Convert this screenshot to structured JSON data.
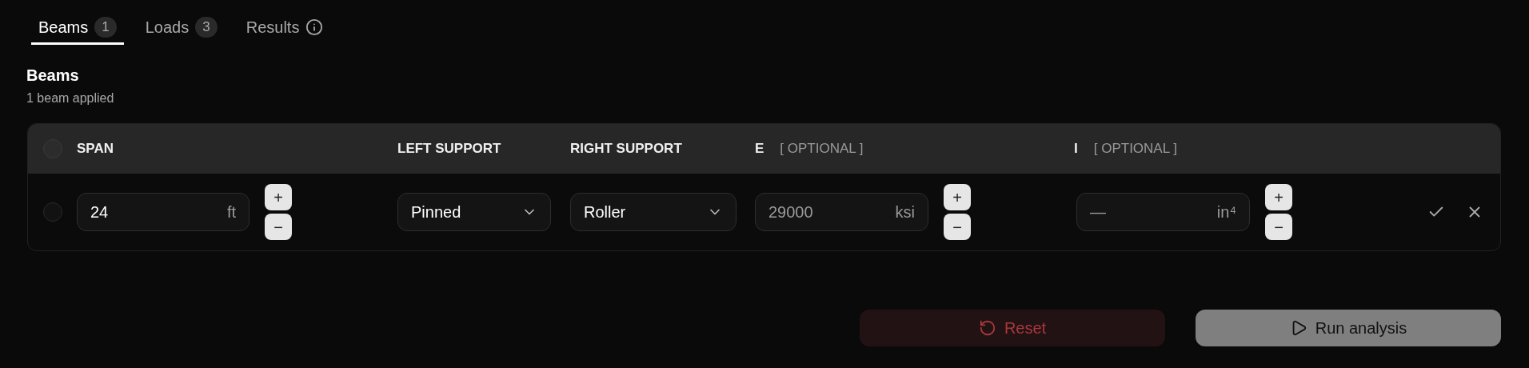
{
  "tabs": [
    {
      "label": "Beams",
      "count": "1",
      "selected": true
    },
    {
      "label": "Loads",
      "count": "3",
      "selected": false
    },
    {
      "label": "Results",
      "info": true,
      "selected": false
    }
  ],
  "section": {
    "title": "Beams",
    "subtitle": "1 beam applied"
  },
  "table": {
    "select_all_checked": false,
    "columns": [
      {
        "label": "SPAN"
      },
      {
        "label": "LEFT SUPPORT"
      },
      {
        "label": "RIGHT SUPPORT"
      },
      {
        "label": "E",
        "hint": "[ OPTIONAL ]"
      },
      {
        "label": "I",
        "hint": "[ OPTIONAL ]"
      }
    ],
    "rows": [
      {
        "checked": false,
        "span": {
          "value": "24",
          "unit": "ft",
          "increment": "+",
          "decrement": "−"
        },
        "left_support": "Pinned",
        "right_support": "Roller",
        "e": {
          "placeholder": "29000",
          "unit": "ksi",
          "increment": "+",
          "decrement": "−"
        },
        "i": {
          "placeholder": "—",
          "unit": "in⁴",
          "increment": "+",
          "decrement": "−"
        }
      }
    ]
  },
  "buttons": [
    {
      "kind": "reset",
      "label": "Reset",
      "disabled": true
    },
    {
      "kind": "run",
      "label": "Run analysis",
      "disabled": true
    }
  ]
}
